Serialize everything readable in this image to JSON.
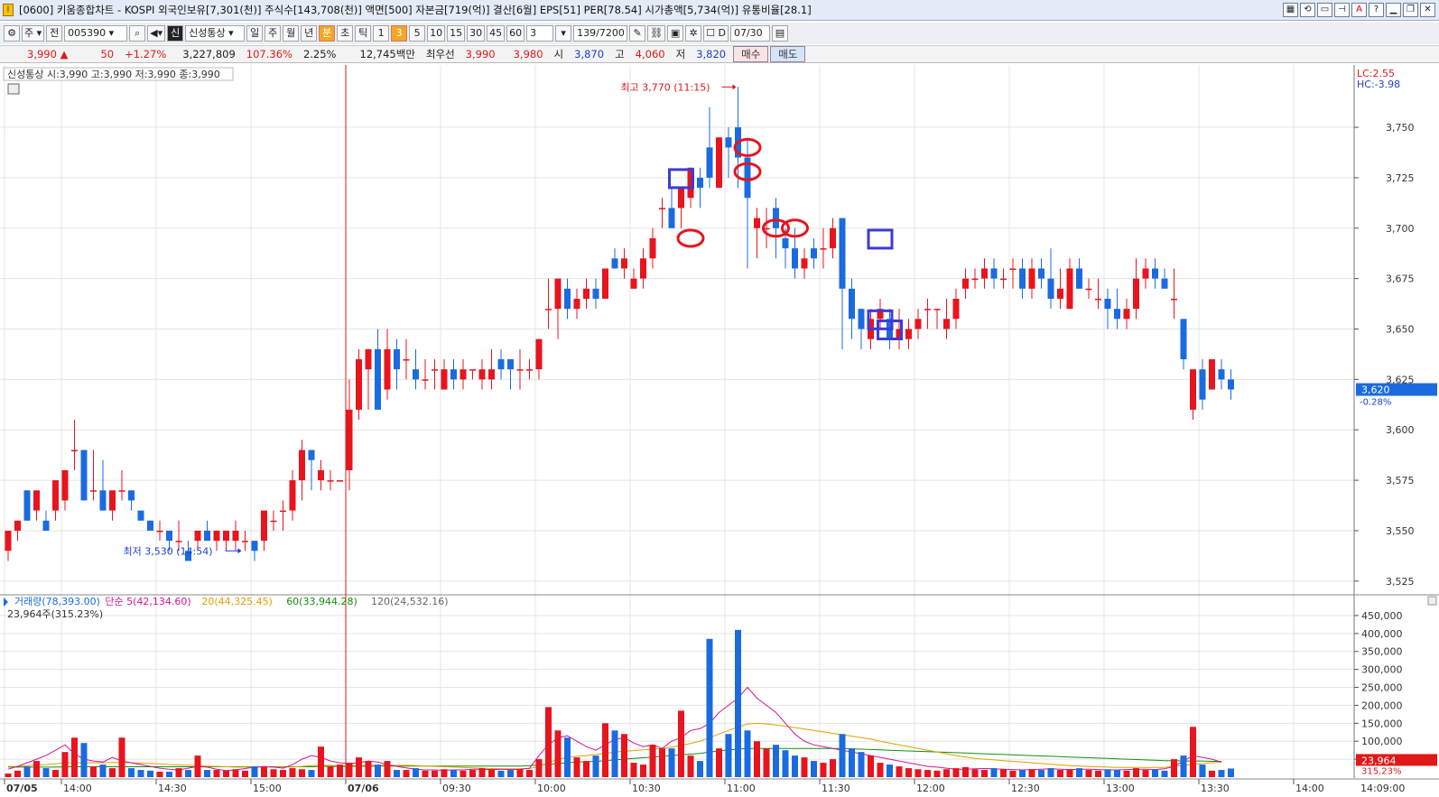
{
  "window": {
    "title": "[0600] 키움종합차트 - KOSPI 외국인보유[7,301(천)] 주식수[143,708(천)] 액면[500] 자본금[719(억)] 결산[6월] EPS[51] PER[78.54] 시가총액[5,734(억)] 유통비율[28.1]",
    "icon_label": "I"
  },
  "toolbar": {
    "market_type": "주",
    "prev_label": "전",
    "code": "005390",
    "name_badge": "신",
    "stock_name": "신성통상",
    "periods": [
      "일",
      "주",
      "월",
      "년",
      "분",
      "초",
      "틱"
    ],
    "selected_period": "분",
    "intervals": [
      "1",
      "3",
      "5",
      "10",
      "15",
      "30",
      "45",
      "60"
    ],
    "selected_interval": "3",
    "interval_input": "3",
    "count": "139/7200",
    "checkbox_label": "D",
    "date": "07/30"
  },
  "quote": {
    "price": "3,990",
    "change": "50",
    "change_pct": "+1.27%",
    "volume": "3,227,809",
    "vol_ratio": "107.36%",
    "turnover": "2.25%",
    "amount": "12,745백만",
    "best_ask_label": "최우선",
    "best_ask": "3,990",
    "best_bid": "3,980",
    "open_label": "시",
    "open": "3,870",
    "high_label": "고",
    "high": "4,060",
    "low_label": "저",
    "low": "3,820",
    "buy_label": "매수",
    "sell_label": "매도"
  },
  "chart_header": {
    "legend": "신성통상 시:3,990 고:3,990 저:3,990 종:3,990",
    "lc": "LC:2.55",
    "hc": "HC:-3.98",
    "current_price": "3,620",
    "current_pct": "-0.28%",
    "high_annotation": "최고 3,770 (11:15)",
    "low_annotation": "최저 3,530 (14:54)",
    "volume_legend": [
      {
        "text": "거래량(78,393.00)",
        "color": "#1b6be0"
      },
      {
        "text": "단순 5(42,134.60)",
        "color": "#d1149a"
      },
      {
        "text": "20(44,325.45)",
        "color": "#e0a000"
      },
      {
        "text": "60(33,944.28)",
        "color": "#109010"
      },
      {
        "text": "120(24,532.16)",
        "color": "#666666"
      }
    ],
    "volume_sub": "23,964주(315.23%)",
    "current_volume": "23,964",
    "current_volume_pct": "315.23%"
  },
  "chart_data": {
    "type": "candlestick",
    "price_ticks": [
      "3,750",
      "3,725",
      "3,700",
      "3,675",
      "3,650",
      "3,625",
      "3,600",
      "3,575",
      "3,550",
      "3,525"
    ],
    "volume_ticks": [
      "450,000",
      "400,000",
      "350,000",
      "300,000",
      "250,000",
      "200,000",
      "150,000",
      "100,000",
      "50,000"
    ],
    "time_labels": [
      "07/05",
      "14:00",
      "14:30",
      "15:00",
      "07/06",
      "09:30",
      "10:00",
      "10:30",
      "11:00",
      "11:30",
      "12:00",
      "12:30",
      "13:00",
      "13:30",
      "14:00",
      "14:09:00"
    ],
    "price_range": [
      3520,
      3780
    ],
    "volume_range": [
      0,
      480000
    ],
    "candles": [
      [
        3540,
        3550,
        3535,
        3550,
        10000
      ],
      [
        3550,
        3555,
        3545,
        3555,
        18000
      ],
      [
        3570,
        3570,
        3555,
        3555,
        30000
      ],
      [
        3560,
        3570,
        3555,
        3570,
        45000
      ],
      [
        3555,
        3560,
        3550,
        3550,
        25000
      ],
      [
        3560,
        3575,
        3555,
        3575,
        20000
      ],
      [
        3565,
        3580,
        3560,
        3580,
        70000
      ],
      [
        3590,
        3605,
        3580,
        3590,
        110000
      ],
      [
        3590,
        3590,
        3565,
        3565,
        95000
      ],
      [
        3570,
        3590,
        3565,
        3570,
        30000
      ],
      [
        3570,
        3585,
        3560,
        3560,
        35000
      ],
      [
        3560,
        3570,
        3555,
        3570,
        25000
      ],
      [
        3570,
        3580,
        3565,
        3570,
        110000
      ],
      [
        3570,
        3570,
        3560,
        3565,
        25000
      ],
      [
        3560,
        3560,
        3555,
        3555,
        20000
      ],
      [
        3555,
        3555,
        3550,
        3550,
        18000
      ],
      [
        3550,
        3555,
        3545,
        3550,
        15000
      ],
      [
        3550,
        3550,
        3540,
        3545,
        15000
      ],
      [
        3545,
        3555,
        3540,
        3545,
        25000
      ],
      [
        3540,
        3545,
        3535,
        3535,
        20000
      ],
      [
        3545,
        3550,
        3540,
        3550,
        60000
      ],
      [
        3550,
        3555,
        3545,
        3545,
        20000
      ],
      [
        3545,
        3550,
        3540,
        3550,
        20000
      ],
      [
        3545,
        3550,
        3540,
        3550,
        18000
      ],
      [
        3545,
        3555,
        3540,
        3550,
        22000
      ],
      [
        3545,
        3550,
        3540,
        3545,
        18000
      ],
      [
        3545,
        3545,
        3535,
        3540,
        30000
      ],
      [
        3545,
        3560,
        3540,
        3560,
        28000
      ],
      [
        3555,
        3560,
        3550,
        3555,
        22000
      ],
      [
        3560,
        3565,
        3550,
        3560,
        20000
      ],
      [
        3560,
        3580,
        3555,
        3575,
        25000
      ],
      [
        3575,
        3595,
        3565,
        3590,
        22000
      ],
      [
        3590,
        3590,
        3570,
        3585,
        20000
      ],
      [
        3575,
        3585,
        3570,
        3580,
        85000
      ],
      [
        3575,
        3580,
        3570,
        3575,
        30000
      ],
      [
        3575,
        3575,
        3575,
        3575,
        35000
      ],
      [
        3580,
        3625,
        3570,
        3610,
        40000
      ],
      [
        3610,
        3640,
        3605,
        3635,
        55000
      ],
      [
        3630,
        3640,
        3610,
        3640,
        45000
      ],
      [
        3640,
        3650,
        3615,
        3610,
        35000
      ],
      [
        3620,
        3650,
        3615,
        3640,
        45000
      ],
      [
        3640,
        3645,
        3620,
        3630,
        20000
      ],
      [
        3635,
        3645,
        3625,
        3635,
        20000
      ],
      [
        3630,
        3640,
        3620,
        3625,
        25000
      ],
      [
        3625,
        3635,
        3620,
        3625,
        18000
      ],
      [
        3630,
        3635,
        3620,
        3630,
        18000
      ],
      [
        3620,
        3635,
        3620,
        3630,
        22000
      ],
      [
        3630,
        3635,
        3620,
        3625,
        20000
      ],
      [
        3625,
        3635,
        3620,
        3630,
        18000
      ],
      [
        3630,
        3630,
        3625,
        3630,
        20000
      ],
      [
        3625,
        3635,
        3620,
        3630,
        25000
      ],
      [
        3625,
        3640,
        3620,
        3630,
        22000
      ],
      [
        3635,
        3640,
        3625,
        3630,
        18000
      ],
      [
        3635,
        3635,
        3620,
        3630,
        20000
      ],
      [
        3630,
        3640,
        3620,
        3630,
        22000
      ],
      [
        3630,
        3635,
        3625,
        3630,
        20000
      ],
      [
        3630,
        3645,
        3625,
        3645,
        50000
      ],
      [
        3660,
        3675,
        3650,
        3660,
        195000
      ],
      [
        3660,
        3675,
        3645,
        3675,
        130000
      ],
      [
        3670,
        3675,
        3655,
        3660,
        110000
      ],
      [
        3660,
        3670,
        3655,
        3665,
        55000
      ],
      [
        3665,
        3675,
        3660,
        3670,
        45000
      ],
      [
        3670,
        3675,
        3660,
        3665,
        60000
      ],
      [
        3665,
        3680,
        3665,
        3680,
        150000
      ],
      [
        3685,
        3690,
        3680,
        3680,
        130000
      ],
      [
        3680,
        3690,
        3675,
        3685,
        120000
      ],
      [
        3670,
        3680,
        3670,
        3675,
        40000
      ],
      [
        3675,
        3690,
        3670,
        3685,
        35000
      ],
      [
        3685,
        3700,
        3680,
        3695,
        90000
      ],
      [
        3710,
        3715,
        3700,
        3710,
        80000
      ],
      [
        3710,
        3720,
        3700,
        3700,
        80000
      ],
      [
        3710,
        3720,
        3700,
        3720,
        185000
      ],
      [
        3715,
        3725,
        3710,
        3730,
        60000
      ],
      [
        3725,
        3730,
        3710,
        3720,
        45000
      ],
      [
        3740,
        3760,
        3720,
        3725,
        385000
      ],
      [
        3720,
        3745,
        3720,
        3745,
        80000
      ],
      [
        3745,
        3750,
        3725,
        3740,
        120000
      ],
      [
        3750,
        3770,
        3720,
        3735,
        410000
      ],
      [
        3735,
        3745,
        3680,
        3715,
        130000
      ],
      [
        3700,
        3710,
        3685,
        3705,
        100000
      ],
      [
        3700,
        3710,
        3690,
        3700,
        80000
      ],
      [
        3710,
        3715,
        3685,
        3700,
        90000
      ],
      [
        3695,
        3700,
        3680,
        3690,
        75000
      ],
      [
        3690,
        3700,
        3675,
        3680,
        60000
      ],
      [
        3680,
        3690,
        3675,
        3685,
        55000
      ],
      [
        3690,
        3695,
        3680,
        3685,
        45000
      ],
      [
        3690,
        3700,
        3680,
        3690,
        40000
      ],
      [
        3690,
        3705,
        3685,
        3700,
        50000
      ],
      [
        3705,
        3705,
        3640,
        3670,
        120000
      ],
      [
        3670,
        3675,
        3645,
        3655,
        80000
      ],
      [
        3660,
        3660,
        3640,
        3650,
        70000
      ],
      [
        3645,
        3660,
        3640,
        3655,
        60000
      ],
      [
        3655,
        3665,
        3650,
        3660,
        40000
      ],
      [
        3655,
        3660,
        3640,
        3645,
        35000
      ],
      [
        3645,
        3660,
        3640,
        3650,
        30000
      ],
      [
        3645,
        3655,
        3640,
        3650,
        25000
      ],
      [
        3650,
        3660,
        3645,
        3655,
        22000
      ],
      [
        3660,
        3665,
        3650,
        3660,
        20000
      ],
      [
        3660,
        3660,
        3650,
        3660,
        18000
      ],
      [
        3650,
        3665,
        3645,
        3655,
        22000
      ],
      [
        3655,
        3670,
        3650,
        3665,
        25000
      ],
      [
        3670,
        3680,
        3665,
        3675,
        28000
      ],
      [
        3675,
        3680,
        3670,
        3675,
        22000
      ],
      [
        3675,
        3685,
        3670,
        3680,
        20000
      ],
      [
        3680,
        3685,
        3670,
        3675,
        25000
      ],
      [
        3675,
        3680,
        3670,
        3675,
        22000
      ],
      [
        3680,
        3685,
        3670,
        3680,
        18000
      ],
      [
        3680,
        3685,
        3665,
        3670,
        20000
      ],
      [
        3670,
        3685,
        3665,
        3680,
        22000
      ],
      [
        3680,
        3685,
        3670,
        3675,
        20000
      ],
      [
        3675,
        3690,
        3660,
        3665,
        25000
      ],
      [
        3665,
        3680,
        3660,
        3670,
        20000
      ],
      [
        3660,
        3685,
        3660,
        3680,
        22000
      ],
      [
        3680,
        3685,
        3670,
        3670,
        25000
      ],
      [
        3670,
        3675,
        3665,
        3670,
        20000
      ],
      [
        3665,
        3675,
        3660,
        3665,
        18000
      ],
      [
        3665,
        3670,
        3650,
        3660,
        22000
      ],
      [
        3660,
        3670,
        3650,
        3655,
        20000
      ],
      [
        3655,
        3665,
        3650,
        3660,
        18000
      ],
      [
        3660,
        3685,
        3655,
        3675,
        25000
      ],
      [
        3675,
        3685,
        3670,
        3680,
        20000
      ],
      [
        3680,
        3685,
        3670,
        3675,
        22000
      ],
      [
        3675,
        3680,
        3670,
        3670,
        18000
      ],
      [
        3665,
        3680,
        3655,
        3665,
        50000
      ],
      [
        3655,
        3655,
        3630,
        3635,
        60000
      ],
      [
        3610,
        3630,
        3605,
        3630,
        140000
      ],
      [
        3630,
        3635,
        3610,
        3615,
        35000
      ],
      [
        3620,
        3635,
        3620,
        3635,
        18000
      ],
      [
        3630,
        3635,
        3620,
        3625,
        20000
      ],
      [
        3625,
        3630,
        3615,
        3620,
        23964
      ]
    ],
    "ma_5": [
      22000,
      30000,
      40000,
      50000,
      60000,
      75000,
      90000,
      65000,
      50000,
      45000,
      42000,
      55000,
      45000,
      40000,
      35000,
      30000,
      25000,
      22000,
      20000,
      25000,
      30000,
      28000,
      22000,
      18000,
      20000,
      24000,
      28000,
      30000,
      28000,
      25000,
      35000,
      50000,
      60000,
      55000,
      45000,
      40000,
      38000,
      40000,
      45000,
      42000,
      35000,
      30000,
      26000,
      22000,
      20000,
      20000,
      19000,
      20000,
      20000,
      22000,
      22000,
      21000,
      22000,
      21000,
      22000,
      25000,
      60000,
      90000,
      110000,
      115000,
      100000,
      85000,
      75000,
      90000,
      105000,
      110000,
      95000,
      85000,
      90000,
      80000,
      100000,
      110000,
      130000,
      135000,
      150000,
      180000,
      200000,
      220000,
      250000,
      220000,
      200000,
      180000,
      150000,
      120000,
      100000,
      90000,
      85000,
      80000,
      75000,
      70000,
      65000,
      60000,
      55000,
      50000,
      45000,
      40000,
      35000,
      30000,
      28000,
      25000,
      22000,
      22000,
      23000,
      24000,
      23000,
      22000,
      21000,
      20000,
      21000,
      22000,
      23000,
      22000,
      21000,
      22000,
      22000,
      21000,
      20000,
      20000,
      21000,
      22000,
      22000,
      21000,
      23000,
      30000,
      45000,
      60000,
      55000,
      50000,
      42000
    ],
    "ma_20": [
      30000,
      30000,
      32000,
      34000,
      35000,
      37000,
      40000,
      40000,
      40000,
      40000,
      40000,
      41000,
      41000,
      40000,
      39000,
      38000,
      37000,
      35000,
      34000,
      33000,
      32000,
      31000,
      30000,
      29000,
      28000,
      28000,
      28000,
      28000,
      28000,
      28000,
      28000,
      30000,
      32000,
      33000,
      33000,
      32000,
      32000,
      32000,
      33000,
      33000,
      33000,
      33000,
      33000,
      32000,
      31000,
      30000,
      29000,
      28000,
      27000,
      26000,
      25000,
      24000,
      23000,
      23000,
      23000,
      24000,
      30000,
      40000,
      50000,
      55000,
      58000,
      60000,
      63000,
      66000,
      70000,
      72000,
      74000,
      76000,
      78000,
      80000,
      84000,
      88000,
      94000,
      100000,
      110000,
      120000,
      130000,
      140000,
      148000,
      150000,
      148000,
      145000,
      142000,
      138000,
      134000,
      130000,
      126000,
      122000,
      118000,
      114000,
      110000,
      106000,
      100000,
      95000,
      90000,
      85000,
      80000,
      75000,
      70000,
      65000,
      60000,
      56000,
      52000,
      50000,
      48000,
      46000,
      44000,
      42000,
      40000,
      38000,
      36000,
      34000,
      32000,
      31000,
      30000,
      29000,
      28000,
      27000,
      27000,
      27000,
      27000,
      27000,
      27000,
      30000,
      33000,
      36000,
      38000,
      40000,
      42000
    ],
    "ma_60": [
      28000,
      28000,
      28000,
      28000,
      28000,
      28000,
      29000,
      29000,
      29000,
      29000,
      29000,
      29000,
      29000,
      29000,
      29000,
      29000,
      29000,
      29000,
      29000,
      29000,
      29000,
      29000,
      29000,
      29000,
      29000,
      29000,
      29000,
      29000,
      29000,
      29000,
      29000,
      29000,
      29000,
      30000,
      30000,
      30000,
      30000,
      30000,
      31000,
      31000,
      31000,
      31000,
      31000,
      31000,
      31000,
      31000,
      31000,
      31000,
      31000,
      31000,
      31000,
      31000,
      31000,
      31000,
      31000,
      32000,
      34000,
      36000,
      38000,
      40000,
      42000,
      43000,
      44000,
      46000,
      48000,
      50000,
      52000,
      54000,
      56000,
      58000,
      60000,
      62000,
      64000,
      66000,
      70000,
      73000,
      76000,
      78000,
      80000,
      80000,
      80000,
      80000,
      80000,
      80000,
      80000,
      80000,
      80000,
      80000,
      80000,
      79000,
      78000,
      77000,
      76000,
      75000,
      74000,
      73000,
      72000,
      71000,
      70000,
      69000,
      68000,
      67000,
      66000,
      65000,
      64000,
      63000,
      62000,
      61000,
      60000,
      59000,
      58000,
      57000,
      56000,
      55000,
      54000,
      53000,
      52000,
      51000,
      50000,
      49000,
      48000,
      47000,
      46000,
      46000,
      45000,
      45000,
      45000,
      44000,
      44000
    ],
    "day_divider_index": 36,
    "time_label_indices": [
      0,
      6,
      16,
      26,
      36,
      46,
      56,
      66,
      76,
      86,
      96,
      106,
      116,
      126,
      136
    ],
    "high_index": 77,
    "low_index": 25,
    "marker_circles": [
      [
        72,
        3695
      ],
      [
        78,
        3740
      ],
      [
        78,
        3728
      ],
      [
        81,
        3700
      ],
      [
        83,
        3700
      ]
    ],
    "marker_squares": [
      [
        71,
        3725
      ],
      [
        92,
        3695
      ],
      [
        92,
        3655
      ],
      [
        93,
        3650
      ]
    ]
  }
}
